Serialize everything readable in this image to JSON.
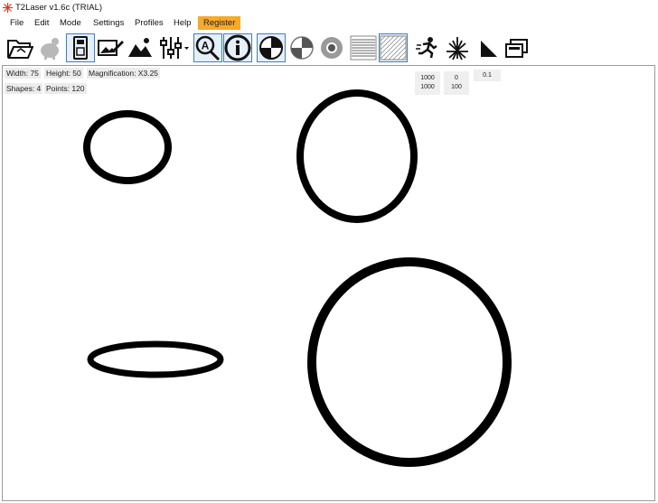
{
  "window": {
    "title": "T2Laser v1.6c (TRIAL)"
  },
  "menu": {
    "file": "File",
    "edit": "Edit",
    "mode": "Mode",
    "settings": "Settings",
    "profiles": "Profiles",
    "help": "Help",
    "register": "Register"
  },
  "toolbar": {
    "buttons": [
      "open-folder-icon",
      "piggy-bank-icon",
      "usb-device-icon",
      "edit-image-icon",
      "image-icon",
      "sliders-icon",
      "search-a-icon",
      "info-icon",
      "contrast-target-icon",
      "half-target-icon",
      "chrome-circle-icon",
      "horizontal-lines-pattern-icon",
      "diagonal-hatch-pattern-icon",
      "running-man-icon",
      "laser-burst-icon",
      "triangle-corner-icon",
      "layers-icon"
    ]
  },
  "status": {
    "width_label": "Width: 75",
    "height_label": "Height: 50",
    "magnification_label": "Magnification: X3.25",
    "shapes_label": "Shapes: 4",
    "points_label": "Points: 120"
  },
  "params": {
    "box1_top": "1000",
    "box1_bottom": "1000",
    "box2_top": "0",
    "box2_bottom": "100",
    "box3_top": "0.1"
  },
  "colors": {
    "accent": "#3c7fd6",
    "register_bg": "#f7a928",
    "shape_stroke": "#000000"
  }
}
